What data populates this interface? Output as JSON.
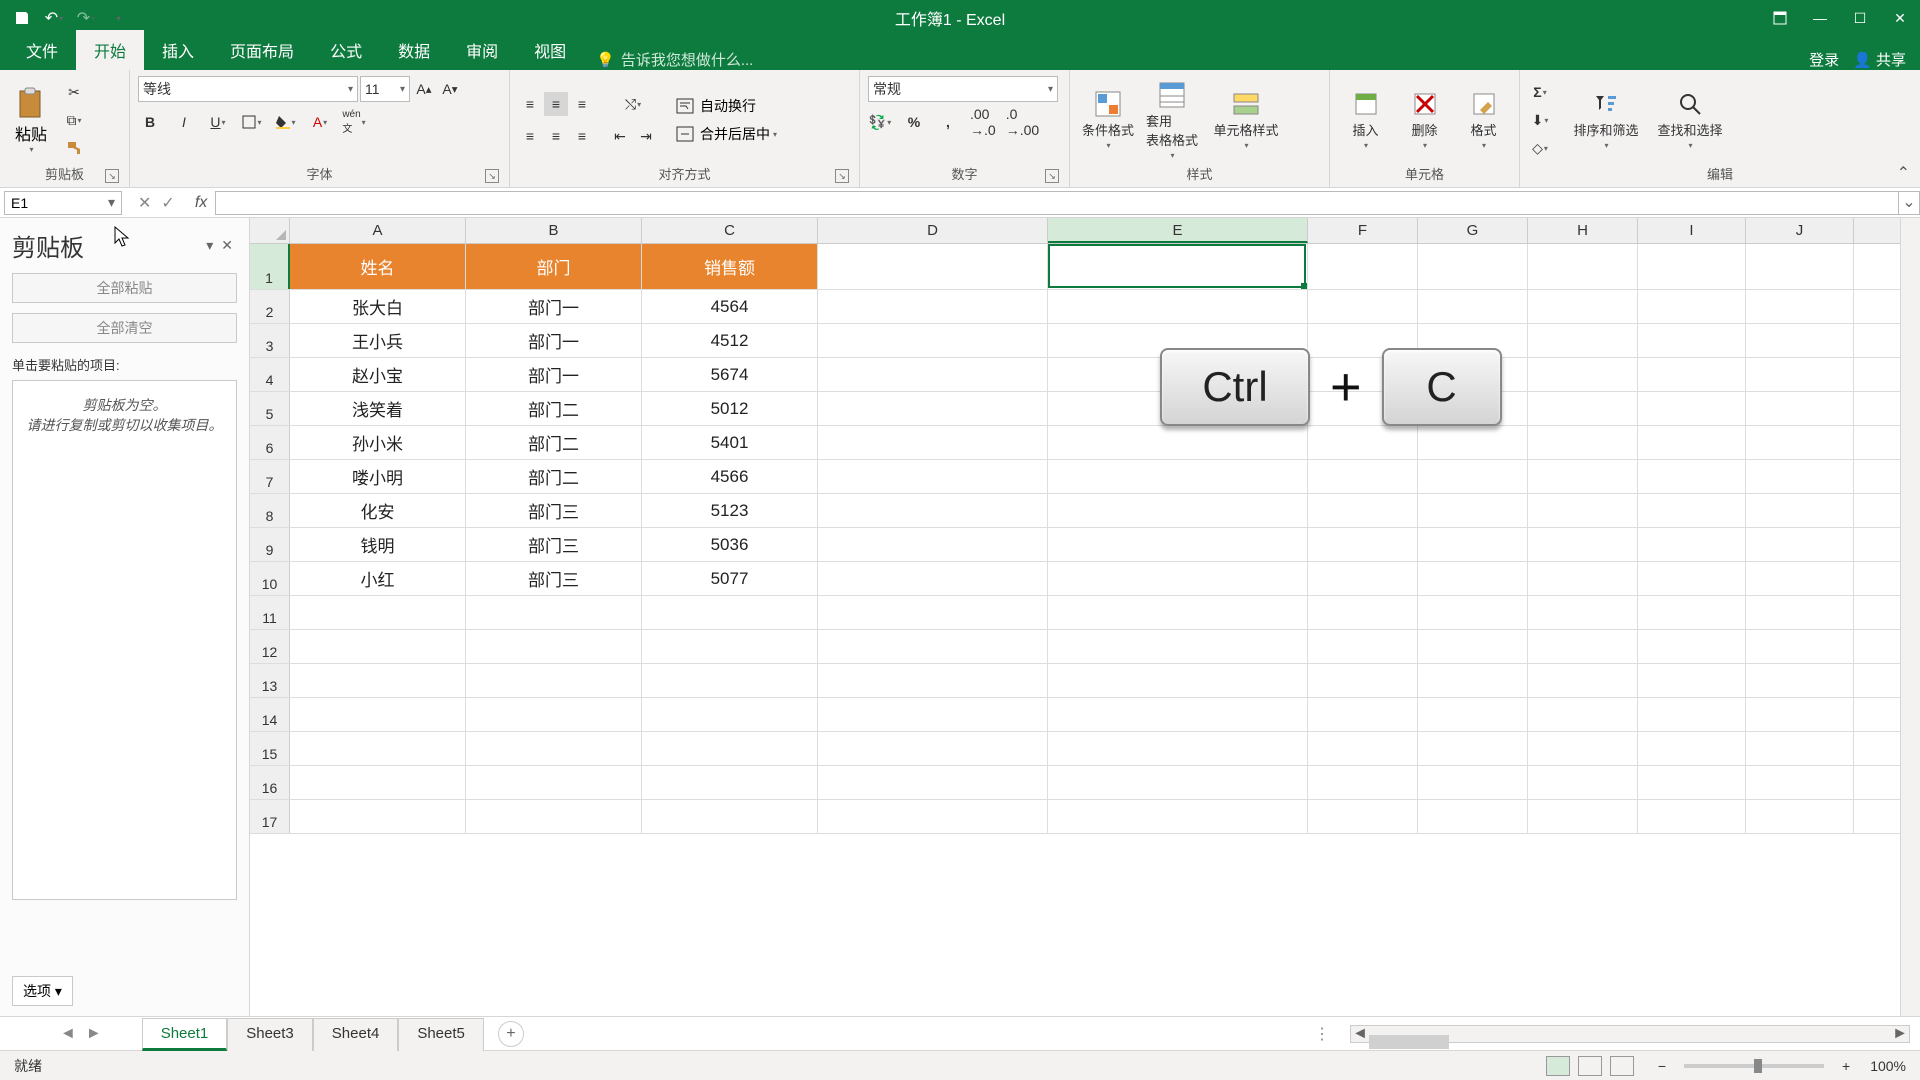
{
  "app": {
    "title": "工作簿1 - Excel",
    "tell_me": "告诉我您想做什么..."
  },
  "tabs": {
    "items": [
      "文件",
      "开始",
      "插入",
      "页面布局",
      "公式",
      "数据",
      "审阅",
      "视图"
    ],
    "active": 1,
    "login": "登录",
    "share": "共享"
  },
  "ribbon": {
    "clipboard": {
      "label": "剪贴板",
      "paste": "粘贴"
    },
    "font": {
      "label": "字体",
      "name": "等线",
      "size": "11"
    },
    "align": {
      "label": "对齐方式",
      "wrap": "自动换行",
      "merge": "合并后居中"
    },
    "number": {
      "label": "数字",
      "format": "常规"
    },
    "styles": {
      "label": "样式",
      "cond": "条件格式",
      "tablefmt": "套用\n表格格式",
      "cellstyle": "单元格样式"
    },
    "cells": {
      "label": "单元格",
      "insert": "插入",
      "delete": "删除",
      "format": "格式"
    },
    "editing": {
      "label": "编辑",
      "sort": "排序和筛选",
      "find": "查找和选择"
    }
  },
  "namebox": "E1",
  "clipboard_pane": {
    "title": "剪贴板",
    "paste_all": "全部粘贴",
    "clear_all": "全部清空",
    "hint": "单击要粘贴的项目:",
    "empty": "剪贴板为空。\n请进行复制或剪切以收集项目。",
    "options": "选项"
  },
  "columns": [
    "A",
    "B",
    "C",
    "D",
    "E",
    "F",
    "G",
    "H",
    "I",
    "J"
  ],
  "selected_col": "E",
  "selected_row": 1,
  "headers": [
    "姓名",
    "部门",
    "销售额"
  ],
  "rows": [
    [
      "张大白",
      "部门一",
      "4564"
    ],
    [
      "王小兵",
      "部门一",
      "4512"
    ],
    [
      "赵小宝",
      "部门一",
      "5674"
    ],
    [
      "浅笑着",
      "部门二",
      "5012"
    ],
    [
      "孙小米",
      "部门二",
      "5401"
    ],
    [
      "喽小明",
      "部门二",
      "4566"
    ],
    [
      "化安",
      "部门三",
      "5123"
    ],
    [
      "钱明",
      "部门三",
      "5036"
    ],
    [
      "小红",
      "部门三",
      "5077"
    ]
  ],
  "empty_rows": [
    11,
    12,
    13,
    14,
    15,
    16,
    17
  ],
  "sheets": {
    "items": [
      "Sheet1",
      "Sheet3",
      "Sheet4",
      "Sheet5"
    ],
    "active": 0
  },
  "status": {
    "ready": "就绪",
    "zoom": "100%"
  },
  "keys": {
    "ctrl": "Ctrl",
    "c": "C"
  }
}
